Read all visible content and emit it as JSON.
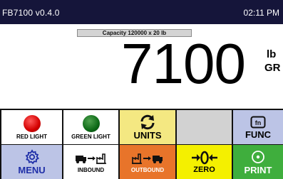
{
  "status_bar": {
    "title": "FB7100 v0.4.0",
    "time": "02:11 PM"
  },
  "display": {
    "capacity": "Capacity 120000 x 20 lb",
    "weight": "7100",
    "unit": "lb",
    "mode": "GR"
  },
  "keys": {
    "red_light": "RED LIGHT",
    "green_light": "GREEN LIGHT",
    "units": "UNITS",
    "blank": "",
    "func": "FUNC",
    "menu": "MENU",
    "inbound": "INBOUND",
    "outbound": "OUTBOUND",
    "zero": "ZERO",
    "print": "PRINT"
  },
  "icons": {
    "red_light": "red-circle-icon",
    "green_light": "green-circle-icon",
    "units": "cycle-arrows-icon",
    "func": "fn-key-icon",
    "menu": "gear-icon",
    "inbound": "truck-to-factory-icon",
    "outbound": "factory-to-truck-icon",
    "zero": "zero-arrows-icon",
    "print": "print-circle-icon"
  },
  "colors": {
    "status_bar": "#15153a",
    "key_yellow": "#f4e882",
    "key_lavender": "#bcc4e6",
    "key_orange": "#e8742a",
    "key_bright_yellow": "#f4f000",
    "key_green": "#3fae3d",
    "key_grey": "#d2d2d2",
    "menu_label": "#1f2fa8"
  }
}
